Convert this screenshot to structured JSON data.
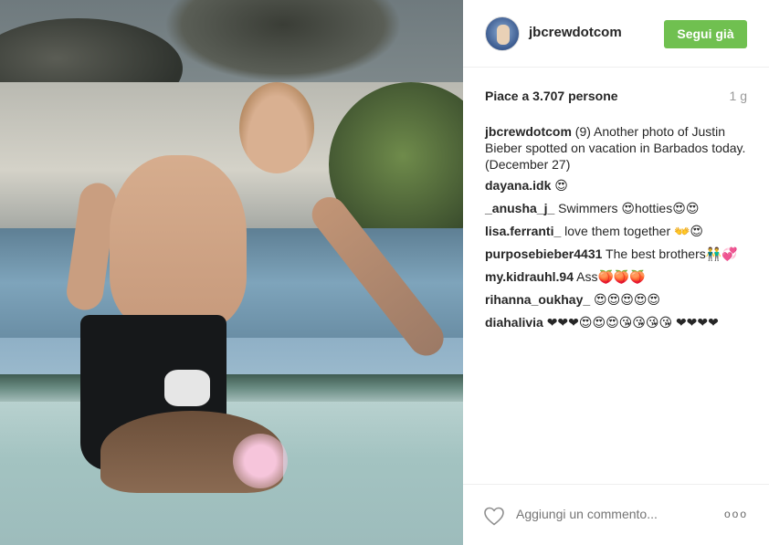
{
  "post": {
    "username": "jbcrewdotcom",
    "follow_label": "Segui già",
    "likes": "Piace a 3.707 persone",
    "age": "1 g",
    "caption": {
      "user": "jbcrewdotcom",
      "text": "(9) Another photo of Justin Bieber spotted on vacation in Barbados today. (December 27)"
    },
    "comments": [
      {
        "user": "dayana.idk",
        "text": "😍"
      },
      {
        "user": "_anusha_j_",
        "text": "Swimmers 😍hotties😍😍"
      },
      {
        "user": "lisa.ferranti_",
        "text": "love them together 👐😍"
      },
      {
        "user": "purposebieber4431",
        "text": "The best brothers👬💞"
      },
      {
        "user": "my.kidrauhl.94",
        "text": "Ass🍑🍑🍑"
      },
      {
        "user": "rihanna_oukhay_",
        "text": "😍😍😍😍😍"
      },
      {
        "user": "diahalivia",
        "text": "❤❤❤😍😍😍😘😘😘😘 ❤❤❤❤"
      }
    ],
    "add_comment_placeholder": "Aggiungi un commento...",
    "more_label": "ooo"
  },
  "colors": {
    "follow_button": "#70c050",
    "muted_text": "#999999",
    "text": "#262626"
  },
  "icons": {
    "like": "heart-outline-icon",
    "more": "ellipsis-icon"
  }
}
